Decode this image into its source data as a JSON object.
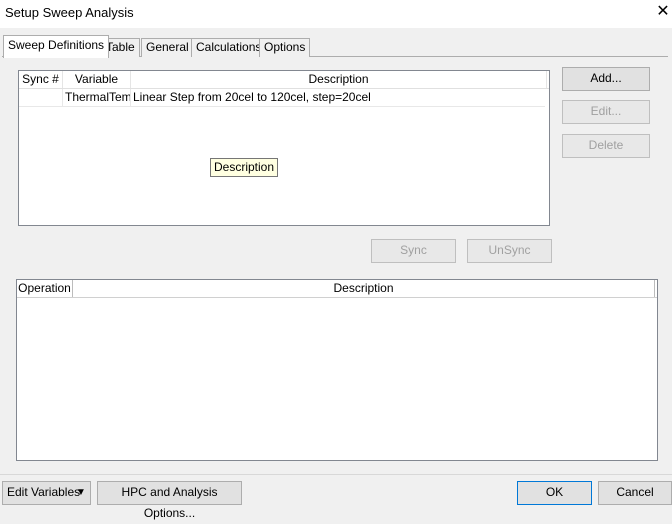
{
  "window": {
    "title": "Setup Sweep Analysis",
    "close_glyph": "✕"
  },
  "tabs": [
    {
      "label": "Sweep Definitions"
    },
    {
      "label": "Table"
    },
    {
      "label": "General"
    },
    {
      "label": "Calculations"
    },
    {
      "label": "Options"
    }
  ],
  "sweep_table": {
    "columns": [
      "Sync #",
      "Variable",
      "Description"
    ],
    "rows": [
      {
        "sync": "",
        "variable": "ThermalTemp",
        "description": "Linear Step from 20cel to 120cel, step=20cel"
      }
    ],
    "tooltip": "Description"
  },
  "side_buttons": {
    "add": "Add...",
    "edit": "Edit...",
    "delete": "Delete"
  },
  "sync_buttons": {
    "sync": "Sync",
    "unsync": "UnSync"
  },
  "operation_table": {
    "columns": [
      "Operation",
      "Description"
    ]
  },
  "footer": {
    "edit_variables": "Edit Variables",
    "hpc_options": "HPC and Analysis Options...",
    "ok": "OK",
    "cancel": "Cancel"
  }
}
